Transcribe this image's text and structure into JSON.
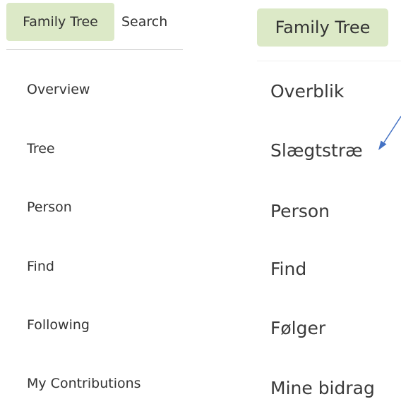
{
  "left_menu": {
    "tabs": [
      {
        "label": "Family Tree",
        "active": true
      },
      {
        "label": "Search",
        "active": false
      }
    ],
    "items": [
      {
        "label": "Overview"
      },
      {
        "label": "Tree"
      },
      {
        "label": "Person"
      },
      {
        "label": "Find"
      },
      {
        "label": "Following"
      },
      {
        "label": "My Contributions"
      }
    ]
  },
  "right_menu": {
    "tab": {
      "label": "Family Tree",
      "active": true
    },
    "items": [
      {
        "label": "Overblik"
      },
      {
        "label": "Slægtstræ"
      },
      {
        "label": "Person"
      },
      {
        "label": "Find"
      },
      {
        "label": "Følger"
      },
      {
        "label": "Mine bidrag"
      }
    ]
  },
  "colors": {
    "active_tab_bg": "#dce9c7",
    "text": "#333333",
    "annotation_arrow": "#4472c4"
  },
  "annotation": {
    "icon": "arrow-icon",
    "points_to": "Slægtstræ"
  }
}
